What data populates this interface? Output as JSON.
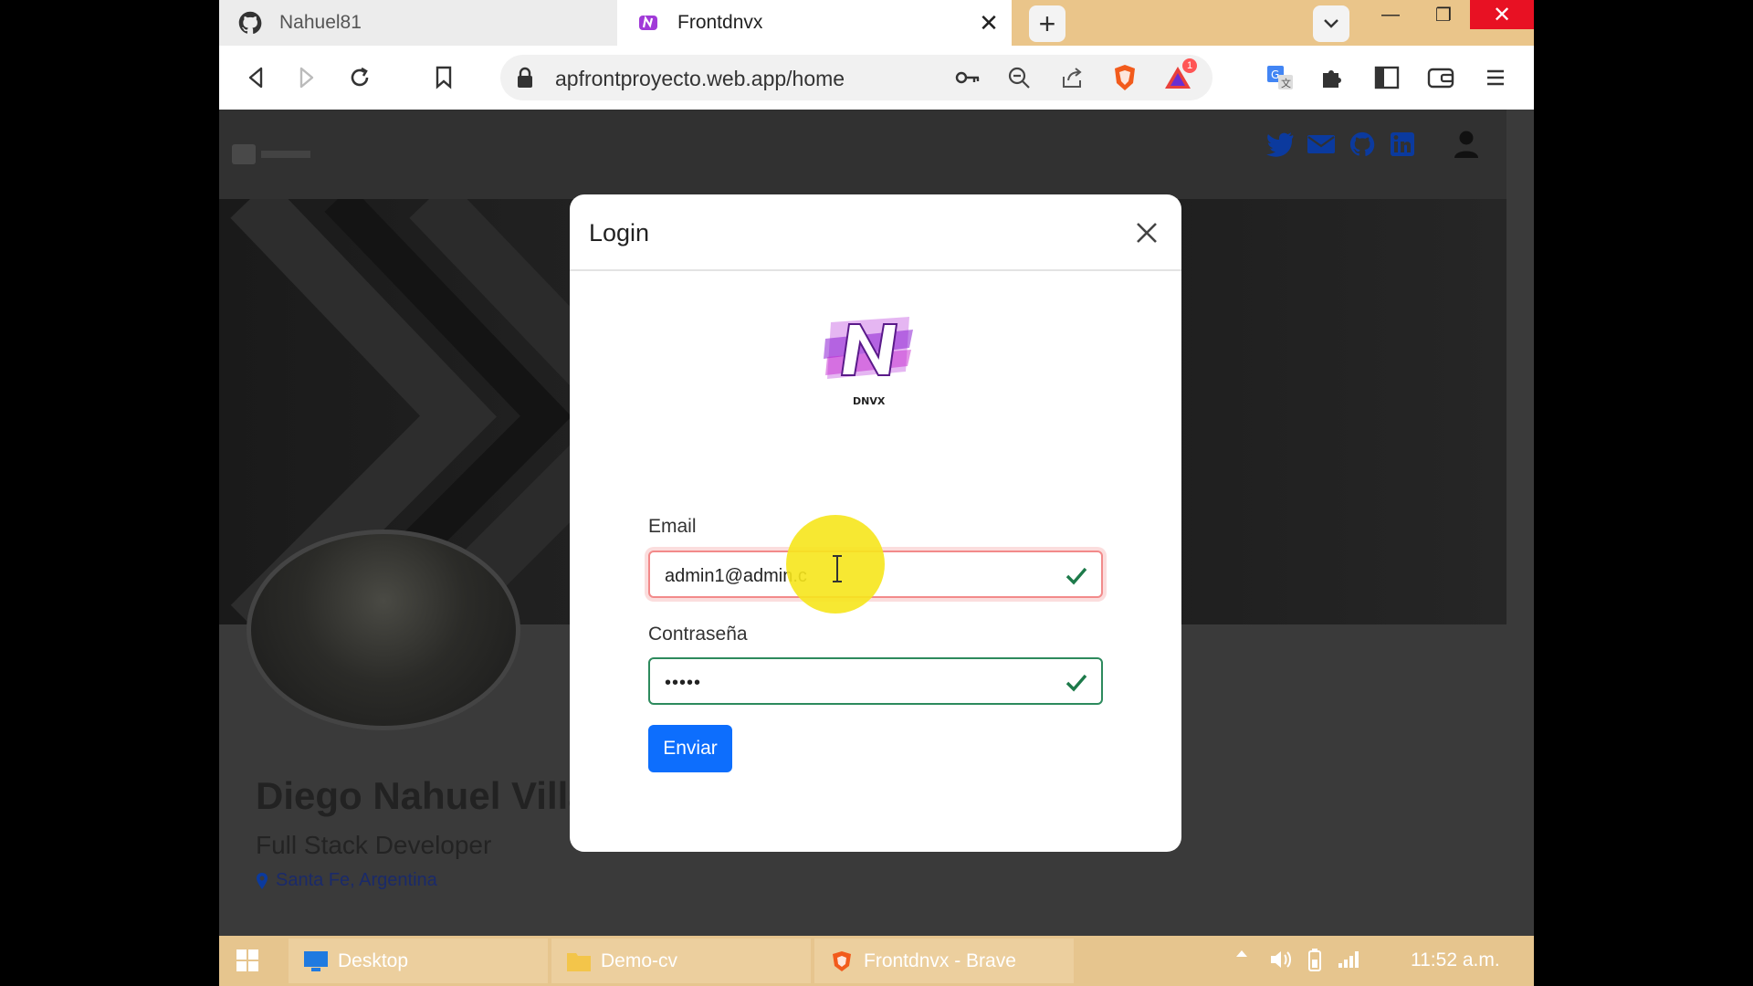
{
  "browser": {
    "tabs": [
      {
        "title": "Nahuel81",
        "icon": "github-icon"
      },
      {
        "title": "Frontdnvx",
        "icon": "dnvx-favicon-icon"
      }
    ],
    "url": "apfrontproyecto.web.app/home",
    "notification_count": "1"
  },
  "modal": {
    "title": "Login",
    "email_label": "Email",
    "email_value": "admin1@admin.c",
    "password_label": "Contraseña",
    "password_value": "•••••",
    "submit_label": "Enviar",
    "logo_text": "DNVX"
  },
  "profile": {
    "name": "Diego Nahuel Villa",
    "role": "Full Stack Developer",
    "location": "Santa Fe, Argentina"
  },
  "taskbar": {
    "items": [
      {
        "label": "Desktop"
      },
      {
        "label": "Demo-cv"
      },
      {
        "label": "Frontdnvx - Brave"
      }
    ],
    "clock": "11:52 a.m."
  },
  "colors": {
    "accent": "#0d6efd",
    "valid": "#2d8a5d",
    "invalid_glow": "#f28a8a",
    "social_icon": "#0b3a9e"
  }
}
